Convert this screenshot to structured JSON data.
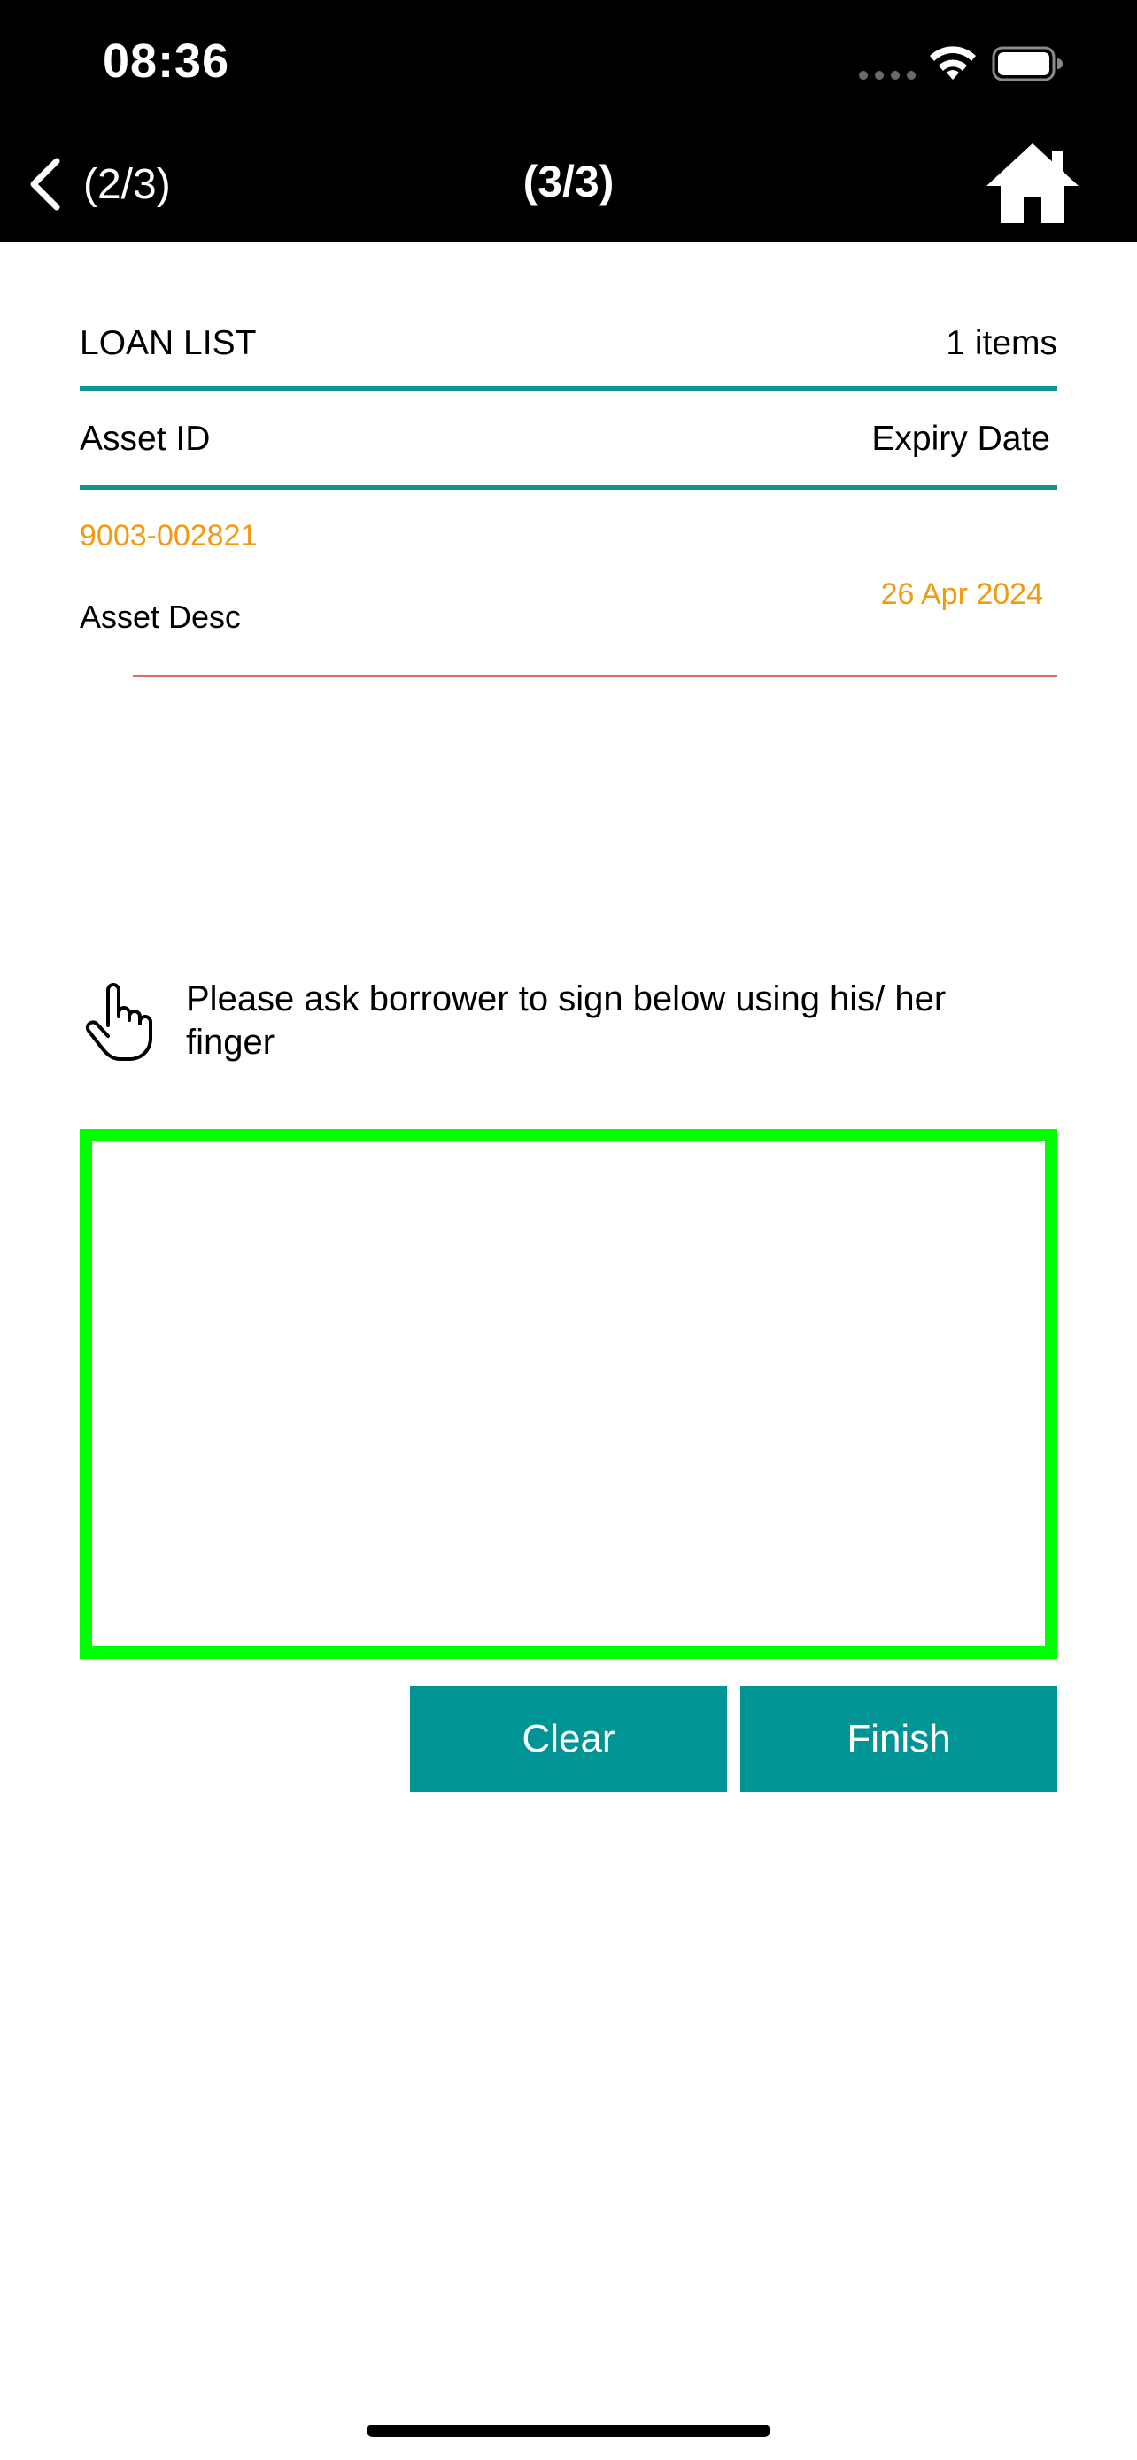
{
  "status_bar": {
    "time": "08:36"
  },
  "nav": {
    "back_label": "(2/3)",
    "title": "(3/3)"
  },
  "loan_list": {
    "title": "LOAN LIST",
    "count": "1 items",
    "columns": [
      "Asset ID",
      "Expiry Date"
    ],
    "rows": [
      {
        "asset_id": "9003-002821",
        "asset_desc": "Asset Desc",
        "expiry_date": "26 Apr 2024"
      }
    ]
  },
  "instruction": {
    "text": "Please ask borrower to sign below using his/ her finger"
  },
  "buttons": {
    "clear": "Clear",
    "finish": "Finish"
  },
  "colors": {
    "accent_teal": "#009494",
    "highlight_orange": "#f39a12",
    "signature_border": "#00ff00",
    "row_divider": "#e06a6a"
  },
  "icons": {
    "back": "chevron-left-icon",
    "home": "home-icon",
    "hand": "hand-pointer-icon",
    "wifi": "wifi-icon",
    "battery": "battery-icon",
    "signal": "cellular-signal-icon"
  }
}
